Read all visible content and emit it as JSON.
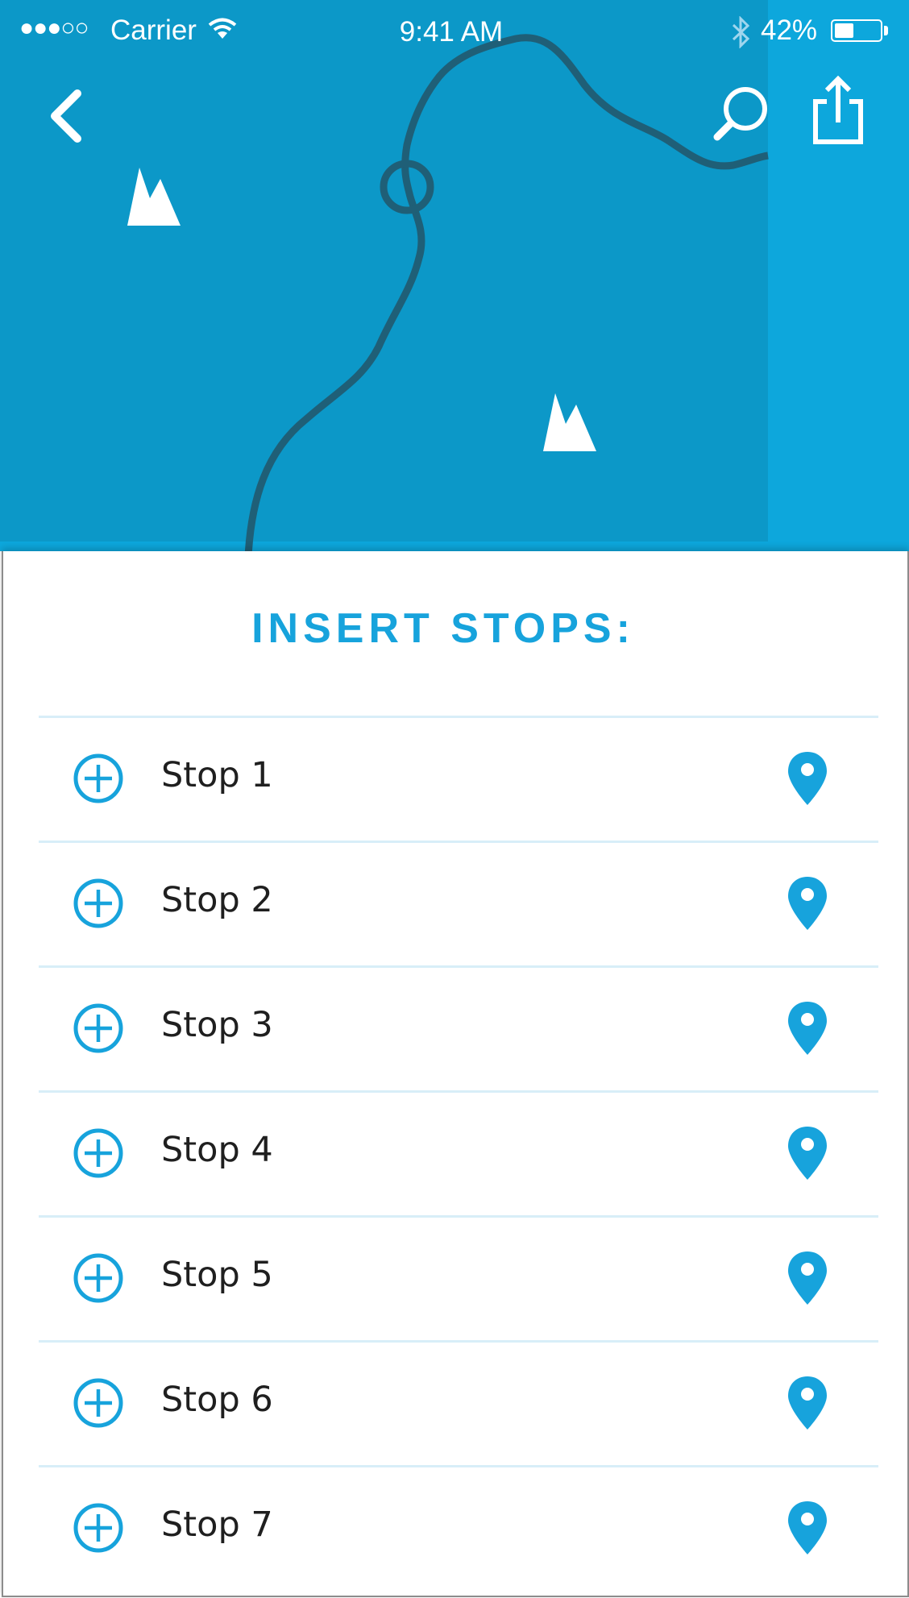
{
  "status_bar": {
    "signal": "●●●○○",
    "carrier": "Carrier",
    "wifi_icon": "wifi-icon",
    "time": "9:41 AM",
    "bluetooth_icon": "bluetooth-icon",
    "battery_percent": "42%",
    "battery_level": 0.42
  },
  "nav": {
    "back_icon": "chevron-left-icon",
    "search_icon": "search-icon",
    "share_icon": "share-icon"
  },
  "map": {
    "route_color": "#1f5f77",
    "background": "#0c98c8",
    "accent_strip": "#0da7dc",
    "landmark_icon": "mountain-icon"
  },
  "stops_panel": {
    "title": "INSERT STOPS:",
    "accent_color": "#17a3dc",
    "items": [
      {
        "label": "Stop 1",
        "add_icon": "plus-circle-icon",
        "pin_icon": "map-pin-icon"
      },
      {
        "label": "Stop 2",
        "add_icon": "plus-circle-icon",
        "pin_icon": "map-pin-icon"
      },
      {
        "label": "Stop 3",
        "add_icon": "plus-circle-icon",
        "pin_icon": "map-pin-icon"
      },
      {
        "label": "Stop 4",
        "add_icon": "plus-circle-icon",
        "pin_icon": "map-pin-icon"
      },
      {
        "label": "Stop 5",
        "add_icon": "plus-circle-icon",
        "pin_icon": "map-pin-icon"
      },
      {
        "label": "Stop 6",
        "add_icon": "plus-circle-icon",
        "pin_icon": "map-pin-icon"
      },
      {
        "label": "Stop 7",
        "add_icon": "plus-circle-icon",
        "pin_icon": "map-pin-icon"
      }
    ]
  }
}
